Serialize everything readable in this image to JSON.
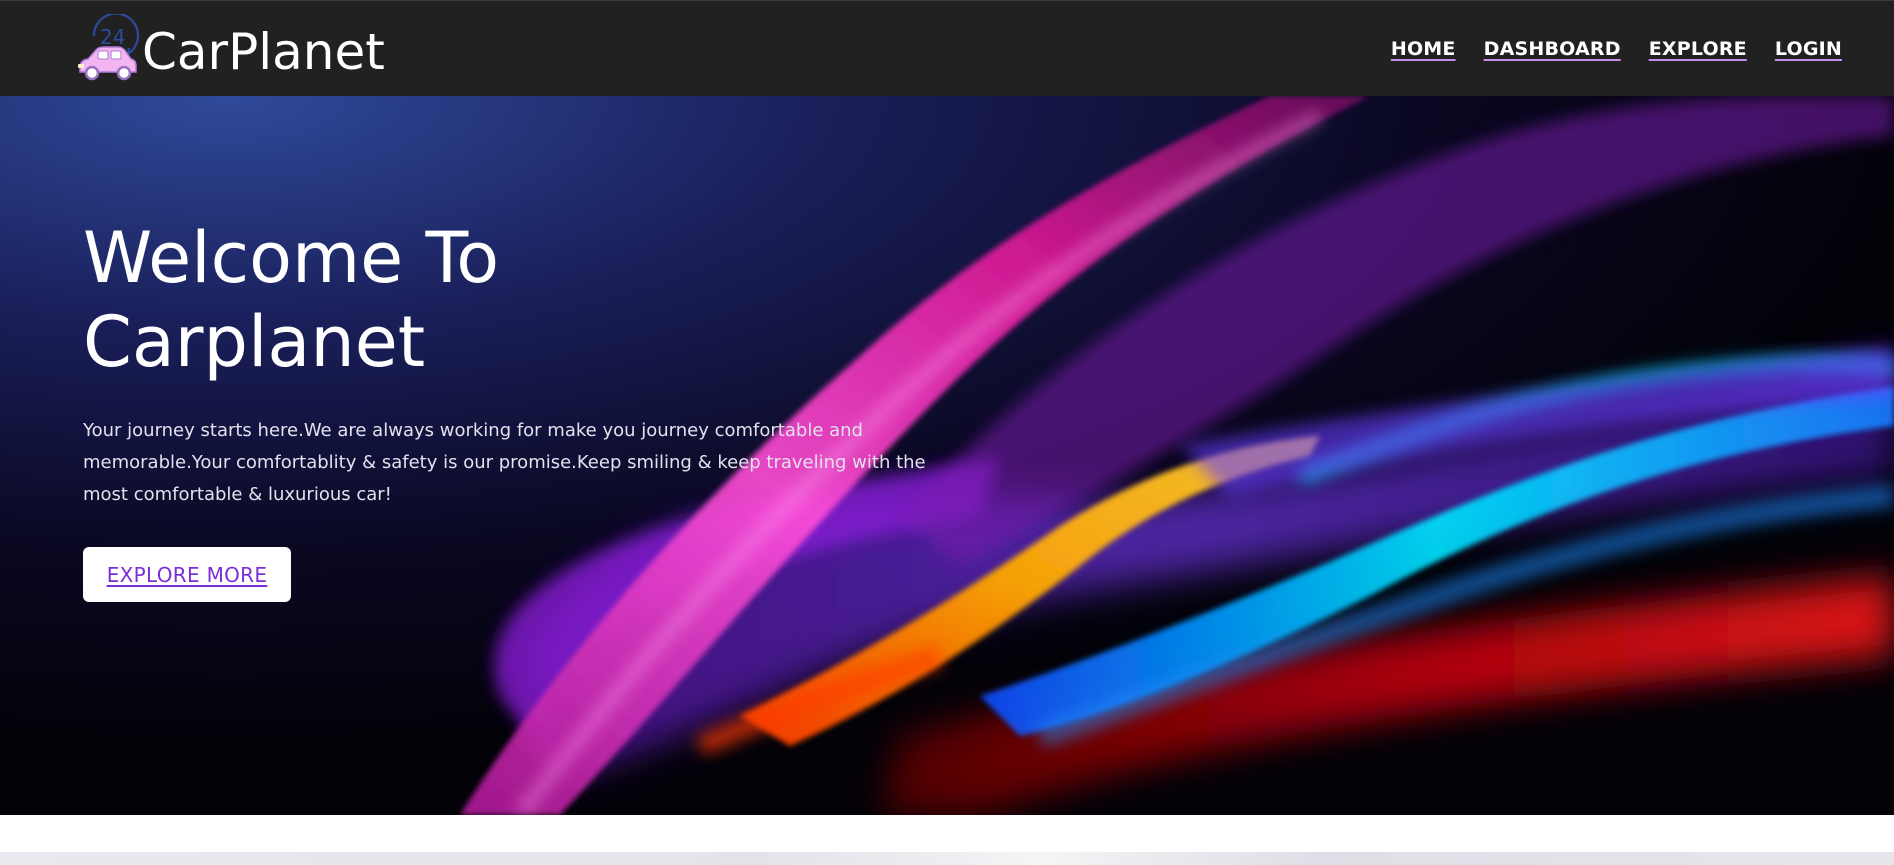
{
  "brand": {
    "name": "CarPlanet",
    "logo_badge": "24"
  },
  "nav": {
    "links": [
      {
        "label": "HOME"
      },
      {
        "label": "DASHBOARD"
      },
      {
        "label": "EXPLORE"
      },
      {
        "label": "LOGIN"
      }
    ]
  },
  "hero": {
    "title_line1": "Welcome To",
    "title_line2": "Carplanet",
    "description": "Your journey starts here.We are always working for make you journey comfortable and memorable.Your comfortablity & safety is our promise.Keep smiling & keep traveling with the most comfortable & luxurious car!",
    "cta_label": "EXPLORE MORE"
  },
  "colors": {
    "navbar_bg": "#212121",
    "accent_purple": "#7b2fd6",
    "nav_underline": "#c58cf0",
    "logo_pink": "#f4a6f0",
    "logo_blue": "#2d4a9c"
  },
  "icons": {
    "logo": "car-24-hours-icon"
  }
}
